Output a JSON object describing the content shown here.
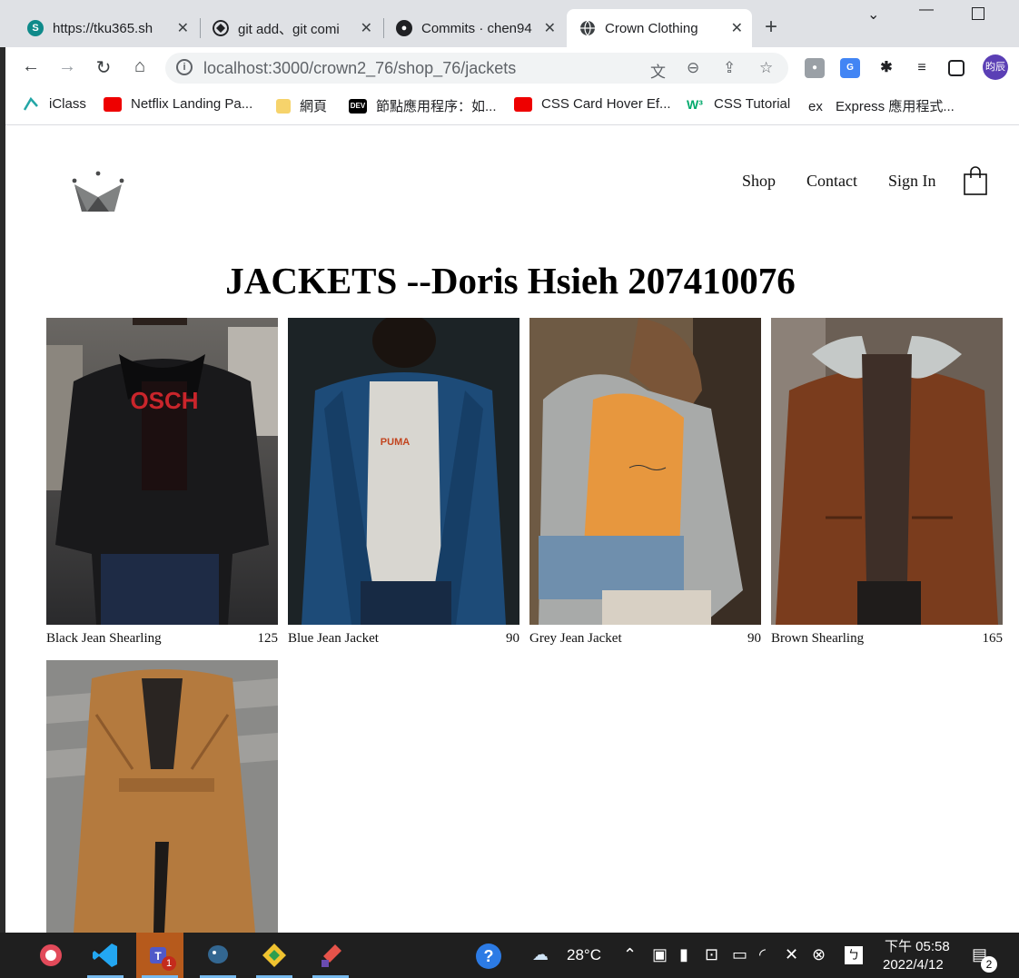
{
  "tabs": [
    {
      "title": "https://tku365.sh",
      "favicon": "sharepoint-icon"
    },
    {
      "title": "git add、git comi",
      "favicon": "git-icon"
    },
    {
      "title": "Commits · chen94",
      "favicon": "github-icon"
    },
    {
      "title": "Crown Clothing",
      "favicon": "globe-icon",
      "active": true
    }
  ],
  "address_bar": {
    "url": "localhost:3000/crown2_76/shop_76/jackets"
  },
  "profile": {
    "label": "昀辰"
  },
  "bookmarks": [
    {
      "label": "iClass",
      "icon": "iclass-icon"
    },
    {
      "label": "Netflix Landing Pa...",
      "icon": "youtube-icon"
    },
    {
      "label": "網頁",
      "icon": "folder-icon"
    },
    {
      "label": "節點應用程序：如...",
      "icon": "dev-icon"
    },
    {
      "label": "CSS Card Hover Ef...",
      "icon": "youtube-icon"
    },
    {
      "label": "CSS Tutorial",
      "icon": "w3schools-icon"
    },
    {
      "label": "Express 應用程式...",
      "icon": "express-icon"
    }
  ],
  "site_nav": {
    "shop": "Shop",
    "contact": "Contact",
    "sign_in": "Sign In"
  },
  "page_title": "JACKETS --Doris Hsieh 207410076",
  "products": [
    {
      "name": "Black Jean Shearling",
      "price": "125"
    },
    {
      "name": "Blue Jean Jacket",
      "price": "90"
    },
    {
      "name": "Grey Jean Jacket",
      "price": "90"
    },
    {
      "name": "Brown Shearling",
      "price": "165"
    },
    {
      "name": "",
      "price": ""
    }
  ],
  "taskbar": {
    "weather": "28°C",
    "time": "下午 05:58",
    "date": "2022/4/12",
    "teams_badge": "1",
    "notifications": "2"
  },
  "text_labels": {
    "jacket1_print": "OSCH",
    "jacket2_print": "PUMA",
    "dev_badge": "DEV",
    "express_badge": "ex",
    "w3_badge": "W³"
  }
}
